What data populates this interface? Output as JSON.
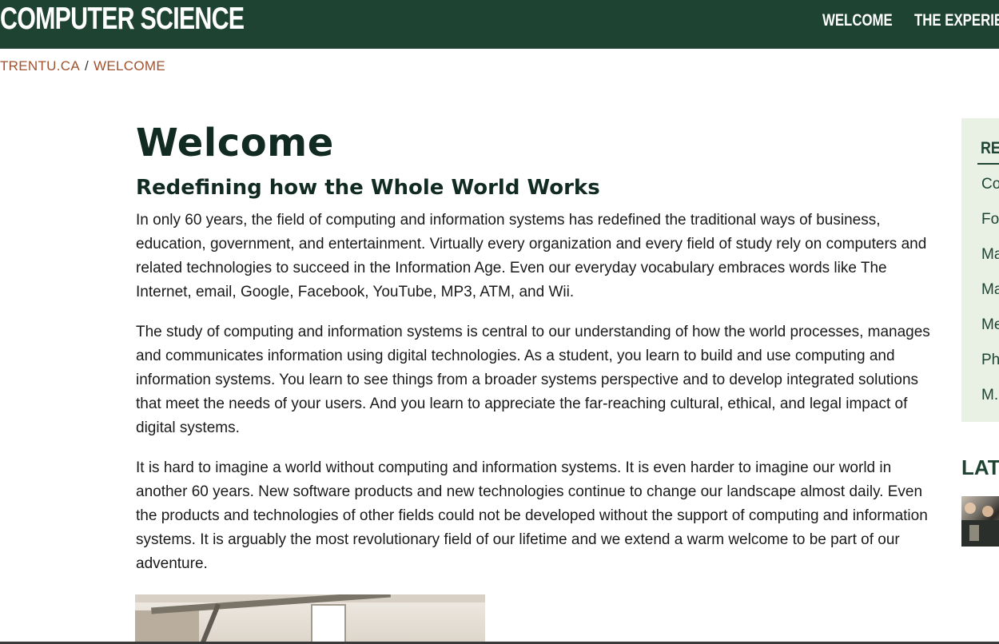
{
  "header": {
    "site_title": "COMPUTER SCIENCE",
    "nav": [
      {
        "label": "WELCOME"
      },
      {
        "label": "THE EXPERIEN"
      }
    ]
  },
  "breadcrumb": {
    "items": [
      {
        "label": "TRENTU.CA"
      },
      {
        "label": "WELCOME"
      }
    ],
    "separator": "/"
  },
  "main": {
    "title": "Welcome",
    "subtitle": "Redefining how the Whole World Works",
    "paragraphs": [
      "In only 60 years, the field of computing and information systems has redefined the traditional ways of business, education, government, and entertainment.  Virtually every organization and every field of study rely on computers and related technologies to succeed in the Information Age.  Even our everyday vocabulary embraces words like The Internet, email, Google, Facebook, YouTube, MP3, ATM, and Wii.",
      "The study of computing and information systems is central to our understanding of how the world processes, manages and communicates information using digital technologies.  As a student, you learn to build and use computing and information systems.  You learn to see things from a broader systems perspective and to develop integrated solutions that meet the needs of your users.  And you learn to appreciate the far-reaching cultural, ethical, and legal impact of digital systems.",
      "It is hard to imagine a world without computing and information systems.  It is even harder to imagine our world in another 60 years.  New software products and new technologies continue to change our landscape almost daily.  Even the products and technologies of other fields could not be developed without the support of computing and information systems.  It is arguably the most revolutionary field of our lifetime and we extend a warm welcome to be part of our adventure."
    ]
  },
  "sidebar": {
    "heading": "REL",
    "links": [
      {
        "label": "Co"
      },
      {
        "label": "Fo"
      },
      {
        "label": "Ma"
      },
      {
        "label": "Ma"
      },
      {
        "label": "Me"
      },
      {
        "label": "Ph"
      },
      {
        "label": "M."
      }
    ],
    "latest_heading": "LAT"
  },
  "colors": {
    "brand_green": "#1e4332",
    "breadcrumb_link": "#a0522d",
    "sidebar_bg": "#e8f1e4"
  }
}
